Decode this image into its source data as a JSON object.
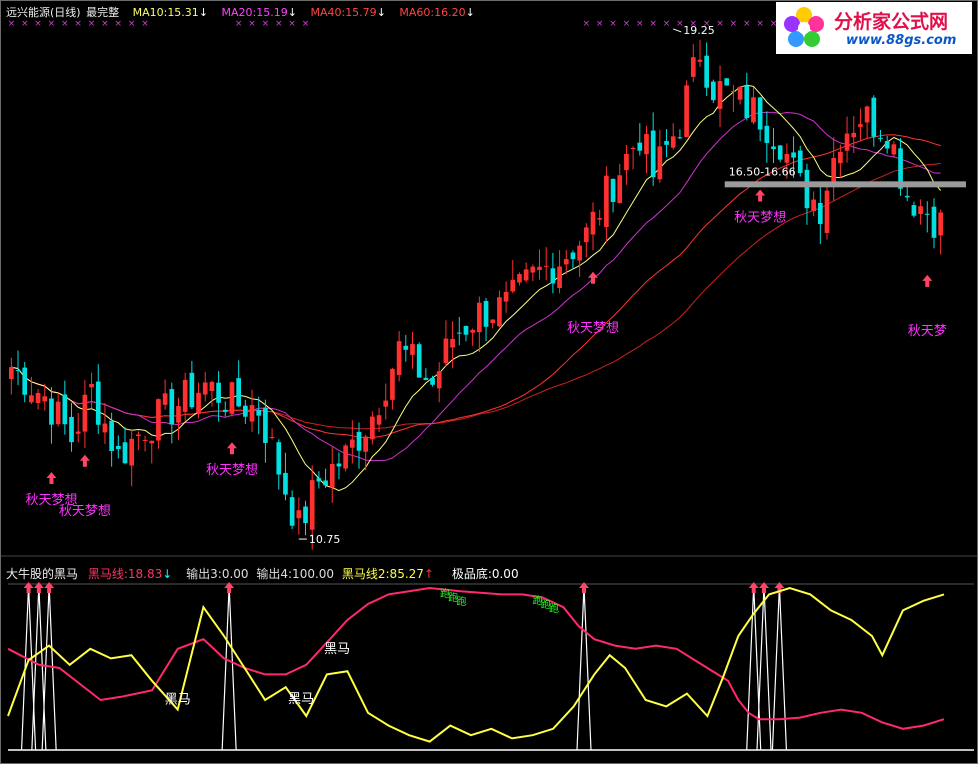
{
  "header": {
    "title": "远兴能源(日线)",
    "adjust": "最完整",
    "ma": [
      {
        "label": "MA10:15.31",
        "arrow": "↓",
        "color": "#ffff66"
      },
      {
        "label": "MA20:15.19",
        "arrow": "↓",
        "color": "#ff44ff"
      },
      {
        "label": "MA40:15.79",
        "arrow": "↓",
        "color": "#ff4444"
      },
      {
        "label": "MA60:16.20",
        "arrow": "↓",
        "color": "#ff4444"
      }
    ]
  },
  "logo": {
    "name": "分析家公式网",
    "url": "www.88gs.com"
  },
  "indicator_header": {
    "name": "大牛股的黑马",
    "line1": "黑马线:18.83",
    "line1_arrow": "↓",
    "out3": "输出3:0.00",
    "out4": "输出4:100.00",
    "line2": "黑马线2:85.27",
    "line2_arrow": "↑",
    "bottom": "极品底:0.00"
  },
  "annotations": {
    "high": "19.25",
    "low": "10.75",
    "range": "16.50-16.66",
    "signal_label": "秋天梦想",
    "signal_label_cut": "秋天梦",
    "heima": "黑马",
    "paopao": "跑"
  },
  "colors": {
    "up": "#ff3030",
    "down": "#00e0e0",
    "ma10": "#ffff80",
    "ma20": "#cc33cc",
    "ma40": "#ff3333",
    "ma60": "#cc2222",
    "signal": "#ff4466",
    "label": "#ff33ff",
    "k_line": "#ff2a6a",
    "d_line": "#ffff44",
    "spike": "#ffffff",
    "green_text": "#22ff22",
    "gray_bar": "#9a9a9a"
  },
  "chart_data": [
    {
      "type": "candlestick",
      "title": "远兴能源(日线)",
      "ylim": [
        10.5,
        19.5
      ],
      "n": 140,
      "close_path": [
        [
          0,
          13.6
        ],
        [
          5,
          13.1
        ],
        [
          9,
          12.4
        ],
        [
          12,
          13.2
        ],
        [
          16,
          12.1
        ],
        [
          20,
          12.6
        ],
        [
          24,
          12.9
        ],
        [
          29,
          13.3
        ],
        [
          33,
          13.0
        ],
        [
          37,
          12.9
        ],
        [
          40,
          11.9
        ],
        [
          43,
          10.9
        ],
        [
          46,
          11.7
        ],
        [
          50,
          12.1
        ],
        [
          54,
          12.8
        ],
        [
          58,
          13.9
        ],
        [
          63,
          13.3
        ],
        [
          66,
          14.1
        ],
        [
          70,
          14.5
        ],
        [
          74,
          14.6
        ],
        [
          78,
          15.1
        ],
        [
          82,
          15.4
        ],
        [
          86,
          15.8
        ],
        [
          90,
          16.7
        ],
        [
          94,
          17.5
        ],
        [
          96,
          16.8
        ],
        [
          100,
          17.7
        ],
        [
          103,
          18.9
        ],
        [
          105,
          18.3
        ],
        [
          108,
          18.1
        ],
        [
          112,
          17.8
        ],
        [
          115,
          17.4
        ],
        [
          118,
          16.6
        ],
        [
          121,
          16.3
        ],
        [
          124,
          17.5
        ],
        [
          127,
          17.8
        ],
        [
          131,
          17.6
        ],
        [
          134,
          16.5
        ],
        [
          137,
          16.2
        ],
        [
          140,
          15.9
        ]
      ],
      "overlay_zones": [
        [
          0,
          21
        ],
        [
          34,
          44
        ],
        [
          85,
          140
        ]
      ],
      "high_annotation": {
        "index": 99,
        "value": 19.25
      },
      "low_annotation": {
        "index": 43,
        "value": 10.75
      },
      "range_annotation": {
        "index": 107,
        "from": 16.5,
        "to": 16.66
      },
      "signals": [
        6,
        11,
        33,
        87,
        112,
        137
      ]
    },
    {
      "type": "line",
      "title": "大牛股的黑马",
      "ylim": [
        0,
        100
      ],
      "series": [
        {
          "name": "黑马线",
          "points": [
            [
              0,
              62
            ],
            [
              6,
              52
            ],
            [
              10,
              50
            ],
            [
              14,
              40
            ],
            [
              18,
              30
            ],
            [
              22,
              32
            ],
            [
              28,
              36
            ],
            [
              33,
              62
            ],
            [
              38,
              68
            ],
            [
              42,
              56
            ],
            [
              46,
              50
            ],
            [
              50,
              46
            ],
            [
              54,
              46
            ],
            [
              58,
              52
            ],
            [
              62,
              66
            ],
            [
              66,
              80
            ],
            [
              70,
              90
            ],
            [
              74,
              96
            ],
            [
              78,
              98
            ],
            [
              82,
              100
            ],
            [
              88,
              98
            ],
            [
              96,
              96
            ],
            [
              100,
              96
            ],
            [
              104,
              94
            ],
            [
              108,
              88
            ],
            [
              111,
              76
            ],
            [
              114,
              68
            ],
            [
              118,
              64
            ],
            [
              122,
              62
            ],
            [
              126,
              64
            ],
            [
              130,
              62
            ],
            [
              134,
              54
            ],
            [
              138,
              46
            ],
            [
              140,
              42
            ],
            [
              142,
              30
            ],
            [
              144,
              22
            ],
            [
              146,
              18
            ],
            [
              150,
              18
            ],
            [
              154,
              19
            ],
            [
              158,
              22
            ],
            [
              162,
              24
            ],
            [
              166,
              22
            ],
            [
              170,
              16
            ],
            [
              174,
              12
            ],
            [
              178,
              14
            ],
            [
              182,
              18
            ]
          ]
        },
        {
          "name": "黑马线2",
          "points": [
            [
              0,
              20
            ],
            [
              4,
              55
            ],
            [
              8,
              64
            ],
            [
              12,
              52
            ],
            [
              16,
              62
            ],
            [
              20,
              56
            ],
            [
              24,
              58
            ],
            [
              28,
              42
            ],
            [
              33,
              24
            ],
            [
              38,
              88
            ],
            [
              42,
              70
            ],
            [
              46,
              50
            ],
            [
              50,
              30
            ],
            [
              54,
              38
            ],
            [
              58,
              20
            ],
            [
              62,
              46
            ],
            [
              66,
              48
            ],
            [
              70,
              22
            ],
            [
              74,
              14
            ],
            [
              78,
              8
            ],
            [
              82,
              4
            ],
            [
              86,
              14
            ],
            [
              90,
              8
            ],
            [
              94,
              12
            ],
            [
              98,
              6
            ],
            [
              102,
              8
            ],
            [
              106,
              12
            ],
            [
              110,
              26
            ],
            [
              114,
              46
            ],
            [
              117,
              58
            ],
            [
              120,
              50
            ],
            [
              124,
              30
            ],
            [
              128,
              26
            ],
            [
              132,
              34
            ],
            [
              136,
              20
            ],
            [
              139,
              44
            ],
            [
              142,
              70
            ],
            [
              145,
              84
            ],
            [
              148,
              96
            ],
            [
              152,
              100
            ],
            [
              156,
              96
            ],
            [
              160,
              86
            ],
            [
              164,
              80
            ],
            [
              168,
              70
            ],
            [
              170,
              58
            ],
            [
              174,
              86
            ],
            [
              178,
              92
            ],
            [
              182,
              96
            ]
          ]
        }
      ],
      "spikes": [
        4,
        6,
        8,
        43,
        112,
        145,
        147,
        150
      ],
      "heima_labels": [
        33,
        57,
        64
      ]
    }
  ]
}
